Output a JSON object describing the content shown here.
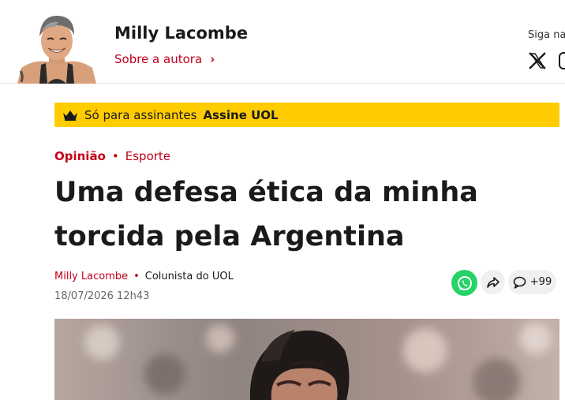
{
  "author": {
    "name": "Milly Lacombe",
    "about_label": "Sobre a autora",
    "about_chevron": "›"
  },
  "social": {
    "follow_label": "Siga na",
    "icons": [
      "x-icon",
      "instagram-icon"
    ]
  },
  "subscriber_banner": {
    "icon": "crown-icon",
    "text": "Só para assinantes",
    "cta": "Assine UOL",
    "background": "#ffcc00"
  },
  "article": {
    "category": "Opinião",
    "separator": "•",
    "section": "Esporte",
    "headline": "Uma defesa ética da minha torcida pela Argentina",
    "byline_author": "Milly Lacombe",
    "byline_role": "Colunista do UOL",
    "date": "18/07/2026 12h43"
  },
  "actions": {
    "whatsapp_icon": "whatsapp-icon",
    "share_icon": "share-icon",
    "comments_icon": "comment-icon",
    "comments_count": "+99"
  },
  "colors": {
    "accent": "#c4001a",
    "banner": "#ffcc00",
    "whatsapp": "#25d366"
  }
}
